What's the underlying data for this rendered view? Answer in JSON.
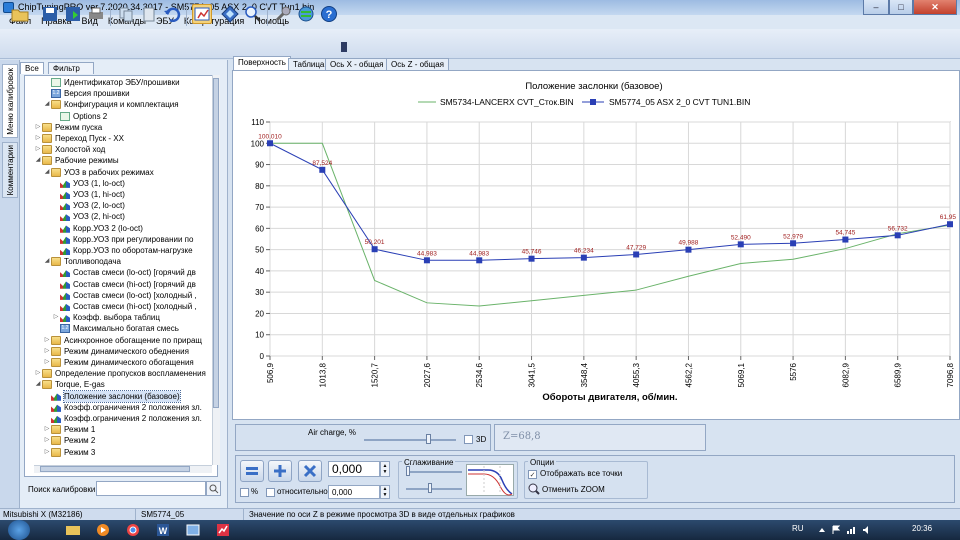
{
  "window": {
    "title": "ChipTuningPRO ver.7.2020.34.3017 - SM5774_05 ASX 2_0 CVT Tun1.bin",
    "minimize": "–",
    "maximize": "□",
    "close": "✕"
  },
  "menu": [
    "Файл",
    "Правка",
    "Вид",
    "Команды",
    "ЭБУ",
    "Конфигурация",
    "Помощь"
  ],
  "side_tabs": {
    "calibrations": "Меню калибровок",
    "comments": "Комментарии"
  },
  "panel_tabs": {
    "all": "Все",
    "filter": "Фильтр"
  },
  "tree": [
    {
      "label": "Идентификатор ЭБУ/прошивки",
      "icon": "check-icon"
    },
    {
      "label": "Версия прошивки",
      "icon": "num-icon"
    },
    {
      "label": "Конфигурация и комплектация",
      "icon": "folder-icon"
    },
    {
      "label": "Options 2",
      "icon": "check-icon"
    },
    {
      "label": "Режим пуска",
      "icon": "folder-icon"
    },
    {
      "label": "Переход Пуск - ХХ",
      "icon": "folder-icon"
    },
    {
      "label": "Холостой ход",
      "icon": "folder-icon"
    },
    {
      "label": "Рабочие режимы",
      "icon": "folder-icon"
    },
    {
      "label": "УОЗ в рабочих режимах",
      "icon": "folder-icon"
    },
    {
      "label": "УОЗ (1, lo-oct)",
      "icon": "chart-icon"
    },
    {
      "label": "УОЗ (1, hi-oct)",
      "icon": "chart-icon"
    },
    {
      "label": "УОЗ (2, lo-oct)",
      "icon": "chart-icon"
    },
    {
      "label": "УОЗ (2, hi-oct)",
      "icon": "chart-icon"
    },
    {
      "label": "Корр.УОЗ 2 (lo-oct)",
      "icon": "chart-icon"
    },
    {
      "label": "Корр.УОЗ при регулировании по",
      "icon": "chart-icon"
    },
    {
      "label": "Корр.УОЗ по оборотам-нагрузке",
      "icon": "chart-icon"
    },
    {
      "label": "Топливоподача",
      "icon": "folder-icon"
    },
    {
      "label": "Состав смеси (lo-oct) [горячий дв",
      "icon": "chart-icon"
    },
    {
      "label": "Состав смеси (hi-oct) [горячий дв",
      "icon": "chart-icon"
    },
    {
      "label": "Состав смеси (lo-oct) [холодный ,",
      "icon": "chart-icon"
    },
    {
      "label": "Состав смеси (hi-oct) [холодный ,",
      "icon": "chart-icon"
    },
    {
      "label": "Коэфф. выбора таблиц",
      "icon": "chart-icon"
    },
    {
      "label": "Максимально богатая смесь",
      "icon": "num-icon"
    },
    {
      "label": "Асинхронное обогащение по приращ",
      "icon": "folder-icon"
    },
    {
      "label": "Режим динамического обеднения",
      "icon": "folder-icon"
    },
    {
      "label": "Режим динамического обогащения",
      "icon": "folder-icon"
    },
    {
      "label": "Определение пропусков воспламенения",
      "icon": "folder-icon"
    },
    {
      "label": "Torque, E-gas",
      "icon": "folder-icon"
    },
    {
      "label": "Положение заслонки (базовое)",
      "icon": "chart-icon"
    },
    {
      "label": "Коэфф.ограничения 2 положения зл.",
      "icon": "chart-icon"
    },
    {
      "label": "Коэфф.ограничения 2 положения зл.",
      "icon": "chart-icon"
    },
    {
      "label": "Режим 1",
      "icon": "folder-icon"
    },
    {
      "label": "Режим 2",
      "icon": "folder-icon"
    },
    {
      "label": "Режим 3",
      "icon": "folder-icon"
    }
  ],
  "search": {
    "label": "Поиск калибровки",
    "value": ""
  },
  "view_tabs": [
    "Поверхность",
    "Таблица",
    "Ось X - общая",
    "Ось Z - общая"
  ],
  "chart_data": {
    "type": "line",
    "title": "Положение заслонки (базовое)",
    "xlabel": "Обороты двигателя, об/мин.",
    "ylabel": "",
    "categories": [
      "506,9",
      "1013,8",
      "1520,7",
      "2027,6",
      "2534,6",
      "3041,5",
      "3548,4",
      "4055,3",
      "4562,2",
      "5069,1",
      "5576",
      "6082,9",
      "6589,9",
      "7096,8"
    ],
    "ylim": [
      0,
      110
    ],
    "yticks": [
      0,
      10,
      20,
      30,
      40,
      50,
      60,
      70,
      80,
      90,
      100,
      110
    ],
    "grid": true,
    "legend": "top",
    "series": [
      {
        "name": "SM5734-LANCERX CVT_Сток.BIN",
        "color": "#6ab36a",
        "marker": "none",
        "values": [
          100,
          100,
          35.5,
          25,
          23.5,
          26,
          28.5,
          31,
          37.5,
          43.5,
          45.5,
          50.5,
          57.5,
          61.5
        ]
      },
      {
        "name": "SM5774_05 ASX 2_0 CVT TUN1.BIN",
        "color": "#2a3fb5",
        "marker": "square",
        "values": [
          100.01,
          87.524,
          50.201,
          44.983,
          44.983,
          45.746,
          46.234,
          47.729,
          49.988,
          52.49,
          52.979,
          54.745,
          56.732,
          61.95
        ],
        "labels": [
          "100,010",
          "87,524",
          "50,201",
          "44,983",
          "44,983",
          "45,746",
          "46,234",
          "47,729",
          "49,988",
          "52,490",
          "52,979",
          "54,745",
          "56,732",
          "61,95"
        ]
      }
    ]
  },
  "air_panel": {
    "label": "Air charge, %",
    "checkbox_3d": "3D"
  },
  "z_readout": "Z=68,8",
  "edit_panel": {
    "value1": "0,000",
    "value2": "0,000",
    "percent": "%",
    "relative": "относительно",
    "smoothing_title": "Сглаживание",
    "options_title": "Опции",
    "show_all_points": "Отображать все точки",
    "cancel_zoom": "Отменить ZOOM"
  },
  "status": {
    "ecu": "Mitsubishi X (M32186)",
    "file": "SM5774_05",
    "message": "Значение по оси Z в режиме просмотра 3D в виде отдельных графиков"
  },
  "taskbar": {
    "lang": "RU",
    "time": "20:36"
  }
}
